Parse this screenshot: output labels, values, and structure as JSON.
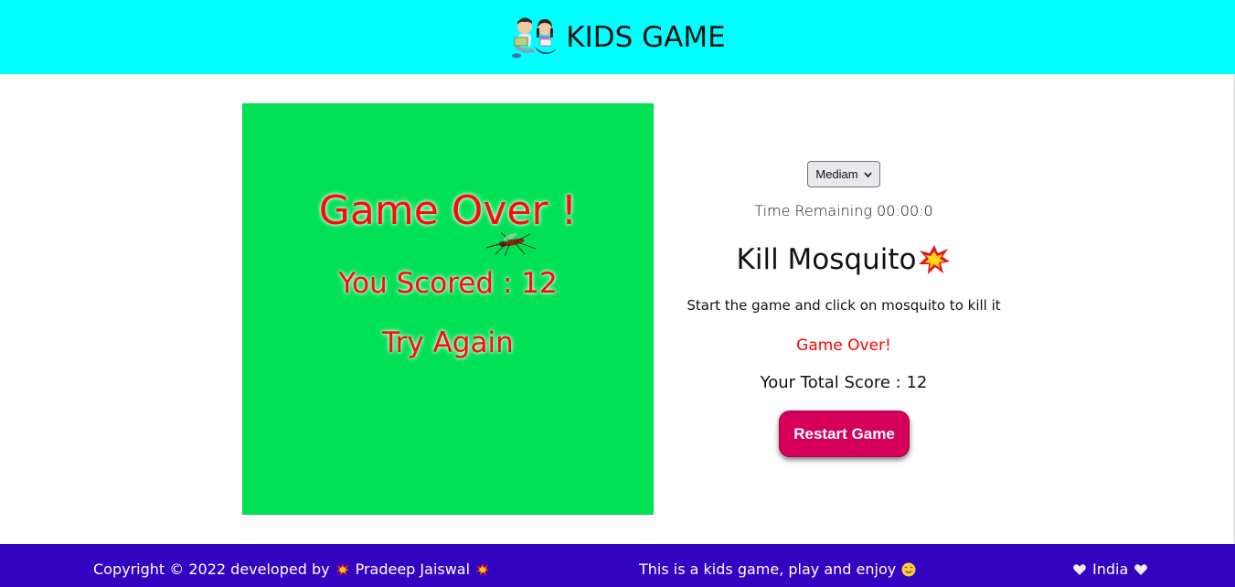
{
  "header": {
    "title": "KIDS GAME",
    "logo_icon": "kids-reading-icon"
  },
  "board": {
    "background": "#00e155",
    "game_over": "Game Over !",
    "scored": "You Scored : 12",
    "try_again": "Try Again",
    "sprite_icon": "mosquito-icon"
  },
  "panel": {
    "level_selected": "Mediam",
    "time_remaining": "Time Remaining 00:00:0",
    "title": "Kill Mosquito",
    "title_icon": "collision-icon",
    "instructions": "Start the game and click on mosquito to kill it",
    "status": "Game Over!",
    "total_score": "Your Total Score : 12",
    "restart_label": "Restart Game"
  },
  "footer": {
    "copyright": "Copyright © 2022 developed by",
    "author": "Pradeep Jaiswal",
    "tagline": "This is a kids game, play and enjoy",
    "country": "India",
    "background": "#3303c2"
  },
  "colors": {
    "header_bg": "#00ffff",
    "accent": "#d6005a",
    "alert": "#ff0000"
  }
}
